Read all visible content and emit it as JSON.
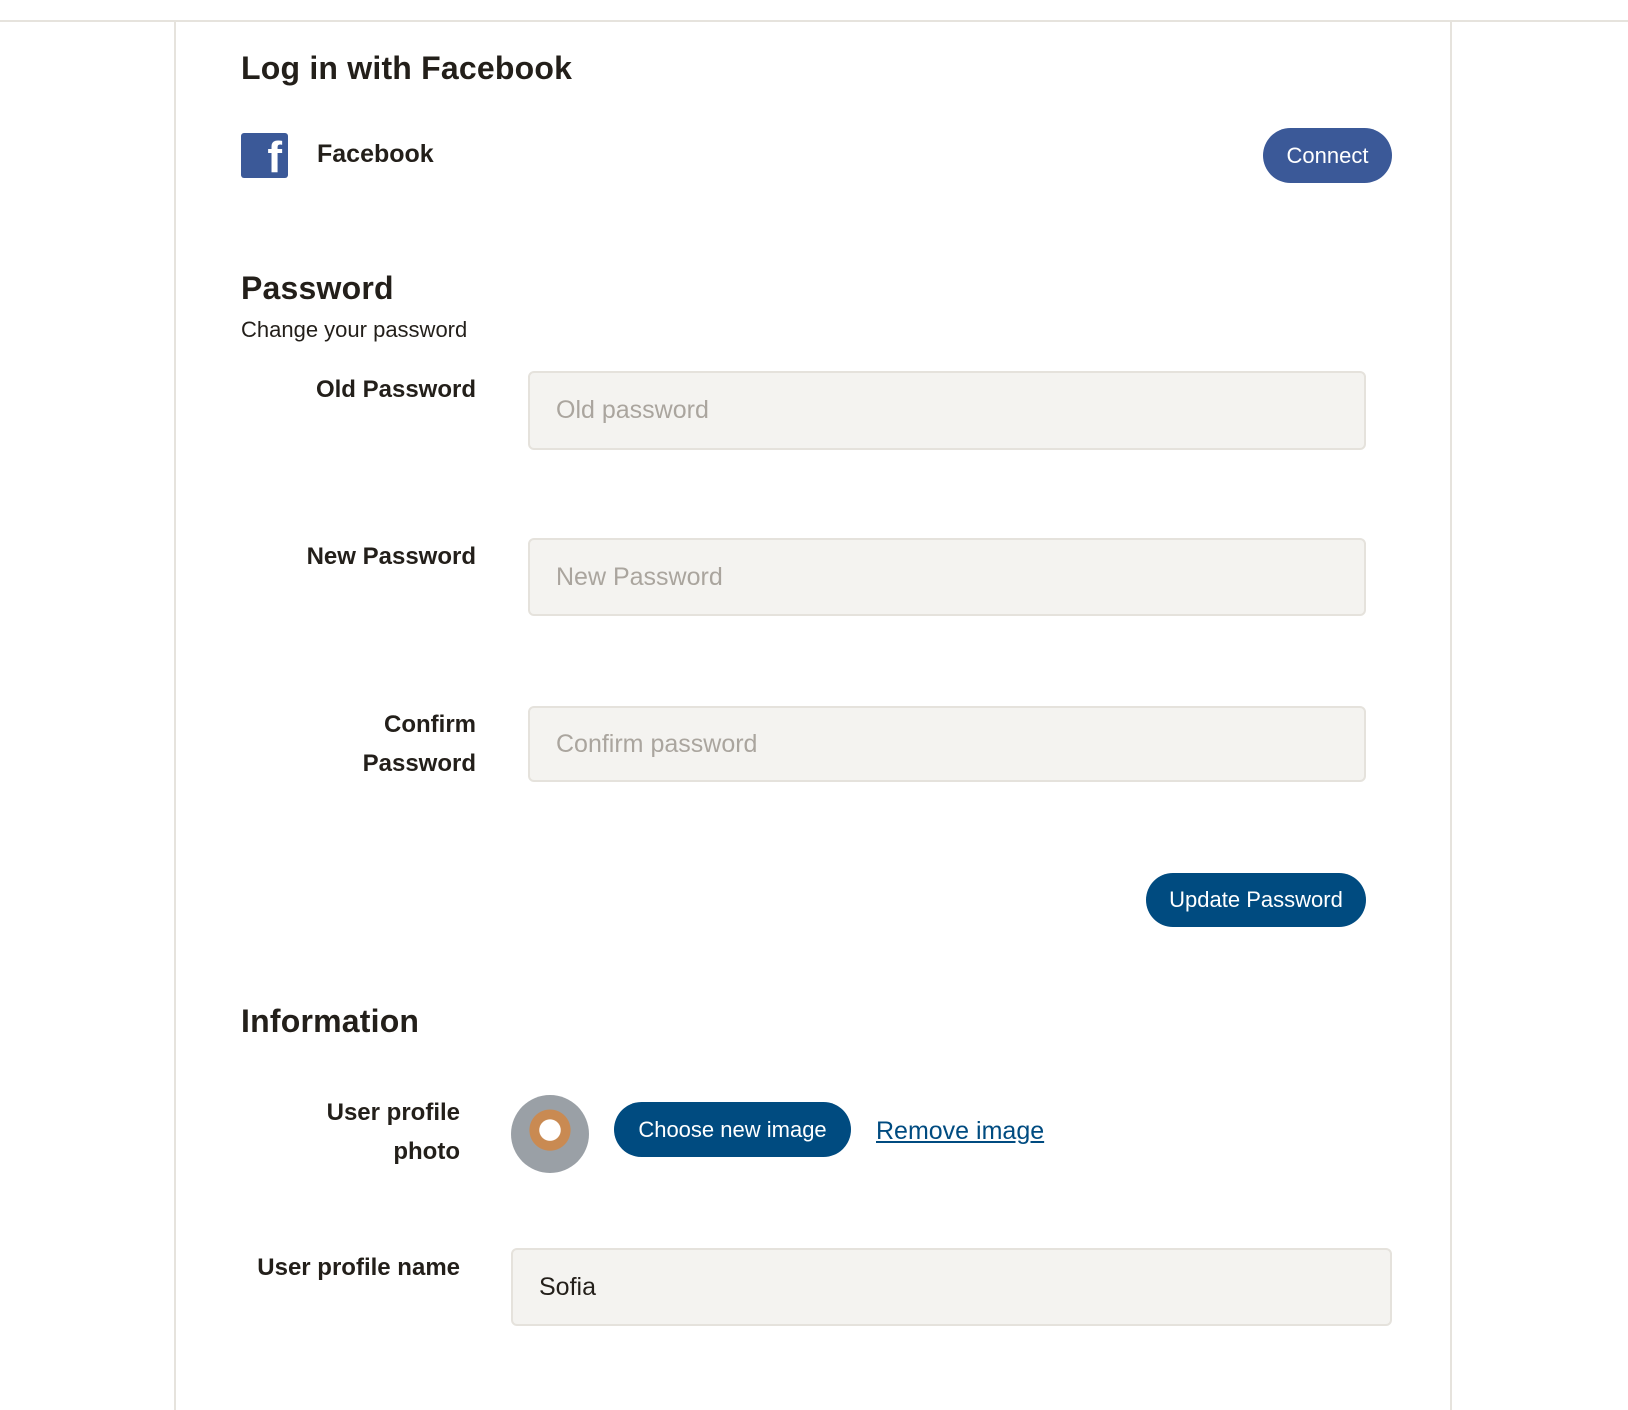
{
  "facebook_section": {
    "title": "Log in with Facebook",
    "provider_icon": "facebook-icon",
    "provider_icon_glyph": "f",
    "provider_label": "Facebook",
    "connect_label": "Connect",
    "brand_color": "#3b5998"
  },
  "password_section": {
    "title": "Password",
    "subtitle": "Change your password",
    "fields": [
      {
        "label": "Old Password",
        "placeholder": "Old password",
        "value": ""
      },
      {
        "label": "New Password",
        "placeholder": "New Password",
        "value": ""
      },
      {
        "label": "Confirm Password",
        "placeholder": "Confirm password",
        "value": ""
      }
    ],
    "update_label": "Update Password"
  },
  "information_section": {
    "title": "Information",
    "photo_label": "User profile photo",
    "avatar_icon": "profile-photo",
    "choose_image_label": "Choose new image",
    "remove_image_label": "Remove image",
    "name_label": "User profile name",
    "name_value": "Sofia"
  },
  "colors": {
    "primary": "#004b80",
    "facebook": "#3b5998",
    "text": "#231f1a",
    "input_bg": "#f4f3f0",
    "border": "#e6e3dd"
  }
}
